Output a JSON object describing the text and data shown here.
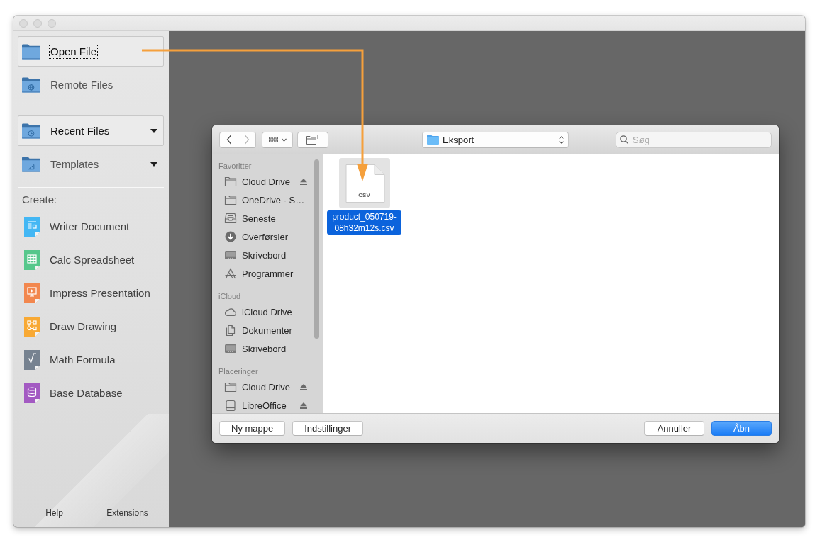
{
  "window": {
    "active": false
  },
  "start_center": {
    "nav_groups": [
      {
        "items": [
          {
            "label": "Open File",
            "kind": "open",
            "highlighted": true,
            "focused": true,
            "dropdown": false
          },
          {
            "label": "Remote Files",
            "kind": "remote",
            "highlighted": false,
            "focused": false,
            "dropdown": false
          }
        ]
      },
      {
        "items": [
          {
            "label": "Recent Files",
            "kind": "recent",
            "highlighted": true,
            "focused": false,
            "dropdown": true
          },
          {
            "label": "Templates",
            "kind": "templates",
            "highlighted": false,
            "focused": false,
            "dropdown": true
          }
        ]
      }
    ],
    "create_label": "Create:",
    "create_items": [
      {
        "label": "Writer Document",
        "kind": "writer",
        "color": "#43b7f4"
      },
      {
        "label": "Calc Spreadsheet",
        "kind": "calc",
        "color": "#55c78b"
      },
      {
        "label": "Impress Presentation",
        "kind": "impress",
        "color": "#f2874e"
      },
      {
        "label": "Draw Drawing",
        "kind": "draw",
        "color": "#f8a934"
      },
      {
        "label": "Math Formula",
        "kind": "math",
        "color": "#768290"
      },
      {
        "label": "Base Database",
        "kind": "base",
        "color": "#a35ac2"
      }
    ],
    "footer_buttons": [
      "Help",
      "Extensions"
    ]
  },
  "open_dialog": {
    "toolbar": {
      "back": {
        "disabled": false
      },
      "forward": {
        "disabled": true
      },
      "location": "Eksport",
      "search": {
        "placeholder": "Søg"
      }
    },
    "sidebar": {
      "sections": [
        {
          "title": "Favoritter",
          "items": [
            {
              "label": "Cloud Drive",
              "kind": "folder",
              "ejectable": true
            },
            {
              "label": "OneDrive - S…",
              "kind": "folder",
              "ejectable": false
            },
            {
              "label": "Seneste",
              "kind": "recents",
              "ejectable": false
            },
            {
              "label": "Overførsler",
              "kind": "downloads",
              "ejectable": false
            },
            {
              "label": "Skrivebord",
              "kind": "desktop",
              "ejectable": false
            },
            {
              "label": "Programmer",
              "kind": "apps",
              "ejectable": false
            }
          ]
        },
        {
          "title": "iCloud",
          "items": [
            {
              "label": "iCloud Drive",
              "kind": "cloud",
              "ejectable": false
            },
            {
              "label": "Dokumenter",
              "kind": "documents",
              "ejectable": false
            },
            {
              "label": "Skrivebord",
              "kind": "desktop",
              "ejectable": false
            }
          ]
        },
        {
          "title": "Placeringer",
          "items": [
            {
              "label": "Cloud Drive",
              "kind": "folder",
              "ejectable": true
            },
            {
              "label": "LibreOffice",
              "kind": "disk",
              "ejectable": true
            }
          ]
        }
      ]
    },
    "files": [
      {
        "name": "product_050719-08h32m12s.csv",
        "type_label": "CSV",
        "selected": true
      }
    ],
    "left_buttons": [
      "Ny mappe",
      "Indstillinger"
    ],
    "right_buttons": [
      {
        "label": "Annuller",
        "default": false
      },
      {
        "label": "Åbn",
        "default": true
      }
    ]
  }
}
